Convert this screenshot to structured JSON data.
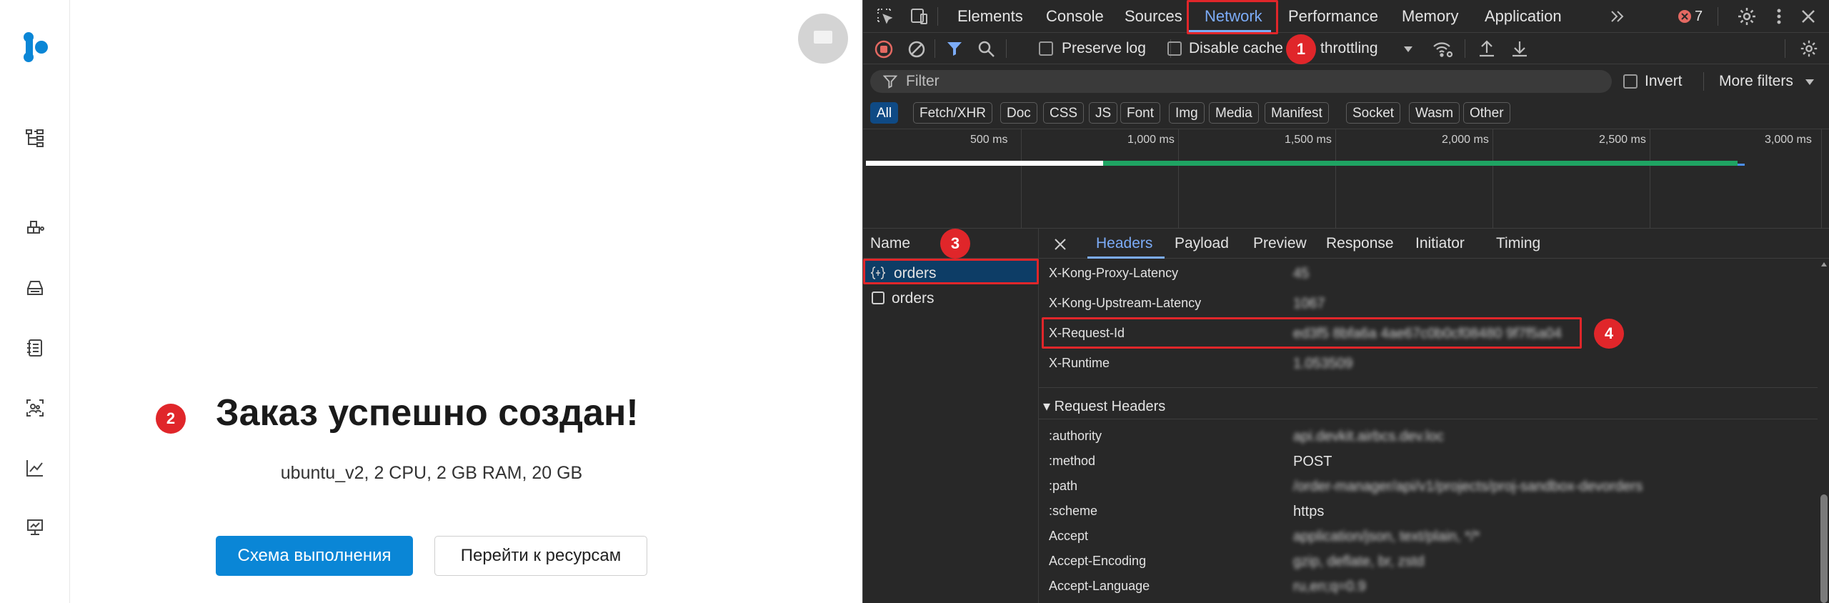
{
  "app": {
    "nav": [
      {
        "name": "services-icon"
      },
      {
        "name": "constructor-icon"
      },
      {
        "name": "storage-icon"
      },
      {
        "name": "documents-icon"
      },
      {
        "name": "users-icon"
      },
      {
        "name": "monitoring-icon"
      },
      {
        "name": "dashboard-icon"
      }
    ],
    "markers": {
      "m1": "1",
      "m2": "2",
      "m3": "3",
      "m4": "4"
    },
    "success_title": "Заказ успешно создан!",
    "success_subtitle": "ubuntu_v2, 2 CPU, 2 GB RAM, 20 GB",
    "btn_scheme": "Схема выполнения",
    "btn_resources": "Перейти к ресурсам"
  },
  "devtools": {
    "tabs": [
      "Elements",
      "Console",
      "Sources",
      "Network",
      "Performance",
      "Memory",
      "Application"
    ],
    "active_tab": "Network",
    "error_count": "7",
    "toolbar": {
      "preserve_log": "Preserve log",
      "disable_cache": "Disable cache",
      "throttling": "throttling"
    },
    "filter": {
      "placeholder": "Filter",
      "invert": "Invert",
      "more_filters": "More filters"
    },
    "types": [
      "All",
      "Fetch/XHR",
      "Doc",
      "CSS",
      "JS",
      "Font",
      "Img",
      "Media",
      "Manifest",
      "Socket",
      "Wasm",
      "Other"
    ],
    "timeline_labels": [
      "500 ms",
      "1,000 ms",
      "1,500 ms",
      "2,000 ms",
      "2,500 ms",
      "3,000 ms"
    ],
    "name_header": "Name",
    "requests": [
      "orders",
      "orders"
    ],
    "detail_tabs": [
      "Headers",
      "Payload",
      "Preview",
      "Response",
      "Initiator",
      "Timing"
    ],
    "response_headers": [
      {
        "name": "X-Kong-Proxy-Latency",
        "value": "45"
      },
      {
        "name": "X-Kong-Upstream-Latency",
        "value": "1067"
      },
      {
        "name": "X-Request-Id",
        "value": "ed3f5 8bfa6a 4ae67c0b0cf08480 9f7f5a04"
      },
      {
        "name": "X-Runtime",
        "value": "1.053509"
      }
    ],
    "request_headers_title": "Request Headers",
    "request_headers": [
      {
        "name": ":authority",
        "value": "api.devkit.airbcs.dev.loc"
      },
      {
        "name": ":method",
        "value": "POST"
      },
      {
        "name": ":path",
        "value": "/order-manager/api/v1/projects/proj-sandbox-devorders"
      },
      {
        "name": ":scheme",
        "value": "https"
      },
      {
        "name": "Accept",
        "value": "application/json, text/plain, */*"
      },
      {
        "name": "Accept-Encoding",
        "value": "gzip, deflate, br, zstd"
      },
      {
        "name": "Accept-Language",
        "value": "ru,en;q=0.9"
      }
    ]
  }
}
